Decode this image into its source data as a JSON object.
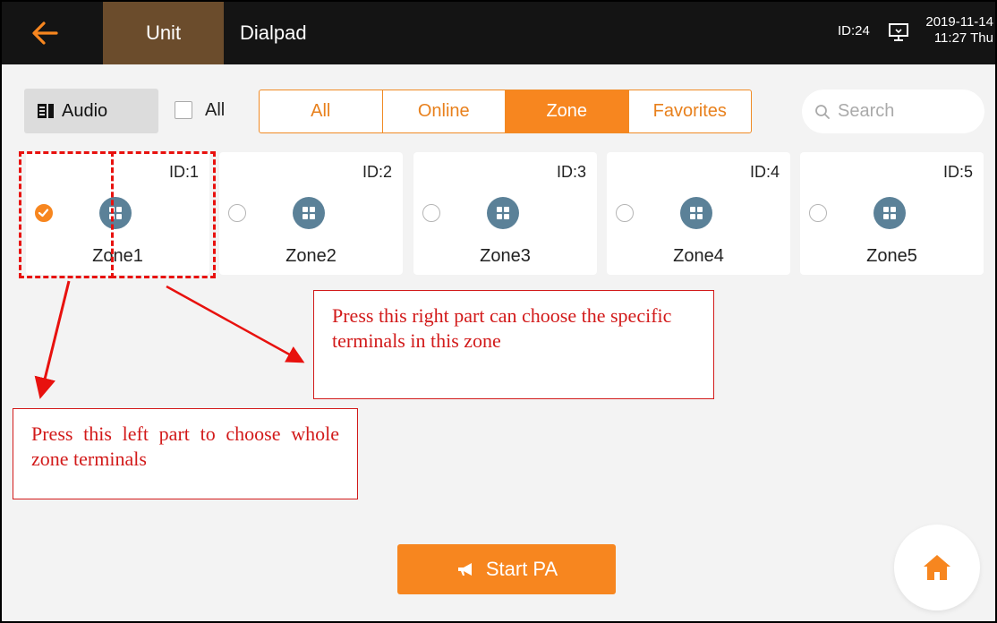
{
  "colors": {
    "accent": "#f7861f",
    "topbar_bg": "#141414",
    "active_tab_bg": "#6b4c2c",
    "zone_icon_bg": "#5b8198",
    "annotation_red": "#d21a1a"
  },
  "topbar": {
    "back_icon": "arrow-left-icon",
    "tabs": [
      {
        "label": "Unit",
        "active": true
      },
      {
        "label": "Dialpad",
        "active": false
      }
    ],
    "device_id": "ID:24",
    "monitor_icon": "monitor-icon",
    "date": "2019-11-14",
    "time_day": "11:27 Thu"
  },
  "filters": {
    "audio_label": "Audio",
    "audio_icon": "list-icon",
    "select_all_label": "All",
    "segments": [
      {
        "label": "All",
        "active": false
      },
      {
        "label": "Online",
        "active": false
      },
      {
        "label": "Zone",
        "active": true
      },
      {
        "label": "Favorites",
        "active": false
      }
    ],
    "search_placeholder": "Search"
  },
  "zones": [
    {
      "id_label": "ID:1",
      "name": "Zone1",
      "selected": true
    },
    {
      "id_label": "ID:2",
      "name": "Zone2",
      "selected": false
    },
    {
      "id_label": "ID:3",
      "name": "Zone3",
      "selected": false
    },
    {
      "id_label": "ID:4",
      "name": "Zone4",
      "selected": false
    },
    {
      "id_label": "ID:5",
      "name": "Zone5",
      "selected": false
    }
  ],
  "annotations": {
    "right_note": "Press this right part can choose the specific terminals in this zone",
    "left_note": "Press this left part to choose whole zone terminals"
  },
  "bottom": {
    "start_pa_label": "Start PA",
    "start_pa_icon": "megaphone-icon",
    "home_icon": "home-icon"
  }
}
